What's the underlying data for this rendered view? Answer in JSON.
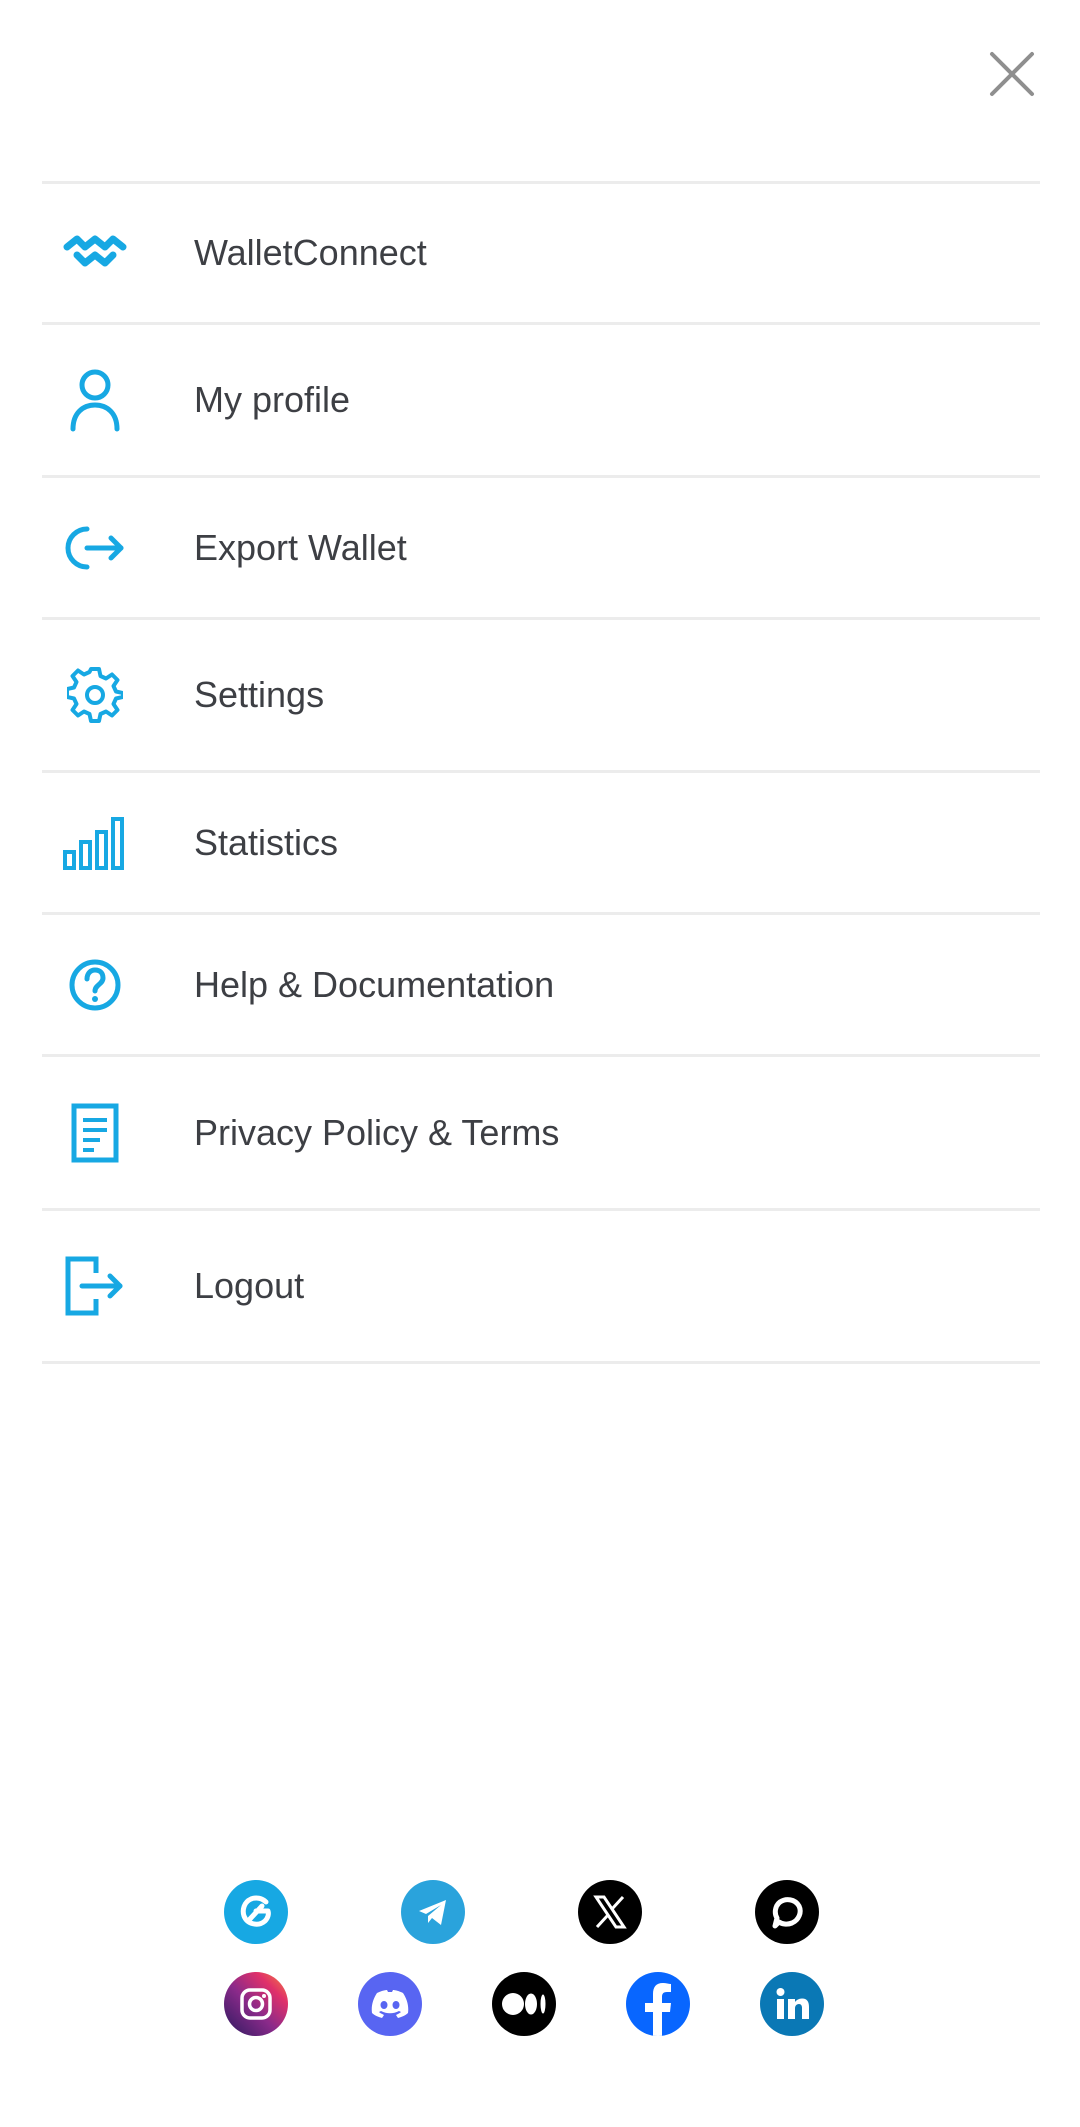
{
  "window": {
    "close_icon": "close-icon"
  },
  "colors": {
    "accent": "#17a8e3",
    "text": "#3d3f44",
    "divider": "#ececec",
    "close": "#8f8f8f"
  },
  "menu": {
    "items": [
      {
        "label": "WalletConnect",
        "icon": "walletconnect-icon"
      },
      {
        "label": "My profile",
        "icon": "user-icon"
      },
      {
        "label": "Export Wallet",
        "icon": "export-icon"
      },
      {
        "label": "Settings",
        "icon": "gear-icon"
      },
      {
        "label": "Statistics",
        "icon": "bar-chart-icon"
      },
      {
        "label": "Help & Documentation",
        "icon": "question-icon"
      },
      {
        "label": "Privacy Policy & Terms",
        "icon": "document-icon"
      },
      {
        "label": "Logout",
        "icon": "logout-icon"
      }
    ]
  },
  "socials": {
    "row1": [
      {
        "name": "guild",
        "icon": "guild-icon",
        "color": "#17a8e3"
      },
      {
        "name": "telegram",
        "icon": "telegram-icon",
        "color": "#2aa3dc"
      },
      {
        "name": "x",
        "icon": "x-icon",
        "color": "#000000"
      },
      {
        "name": "chat",
        "icon": "chat-bubble-icon",
        "color": "#000000"
      }
    ],
    "row2": [
      {
        "name": "instagram",
        "icon": "instagram-icon",
        "color": "#c13584"
      },
      {
        "name": "discord",
        "icon": "discord-icon",
        "color": "#5865f2"
      },
      {
        "name": "medium",
        "icon": "medium-icon",
        "color": "#000000"
      },
      {
        "name": "facebook",
        "icon": "facebook-icon",
        "color": "#0866ff"
      },
      {
        "name": "linkedin",
        "icon": "linkedin-icon",
        "color": "#0a78b5"
      }
    ]
  }
}
